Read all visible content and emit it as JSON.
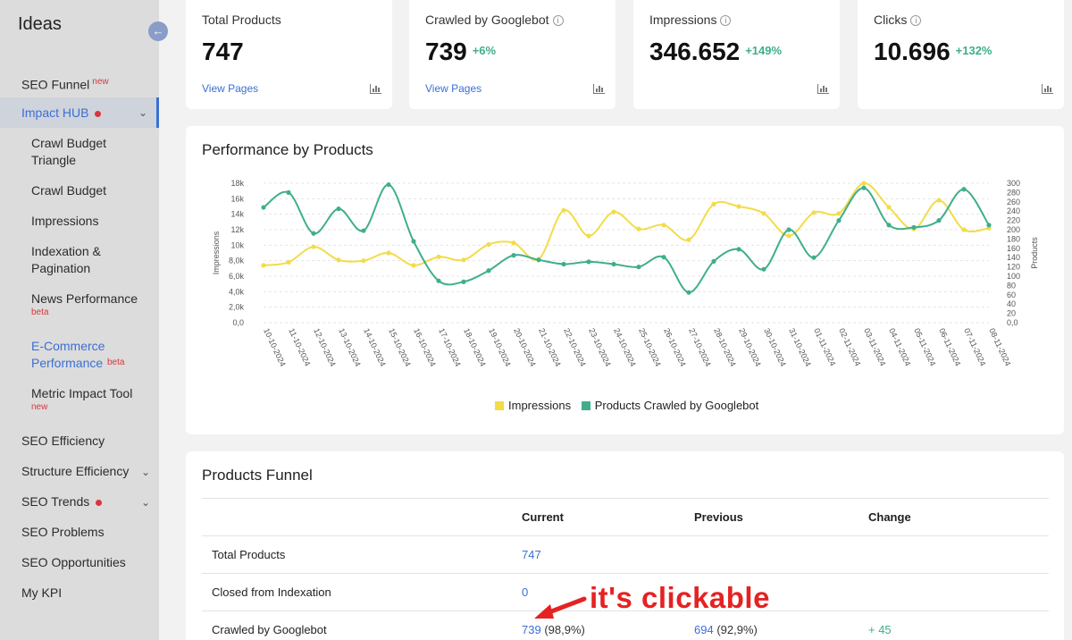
{
  "sidebar": {
    "title": "Ideas",
    "collapse_icon": "arrow-left-icon",
    "items": [
      {
        "label": "SEO Funnel",
        "badge": "new"
      },
      {
        "label": "Impact HUB"
      },
      {
        "label": "Crawl Budget Triangle"
      },
      {
        "label": "Crawl Budget"
      },
      {
        "label": "Impressions"
      },
      {
        "label": "Indexation & Pagination"
      },
      {
        "label": "News Performance",
        "badge": "beta"
      },
      {
        "label": "E-Commerce Performance",
        "badge": "beta"
      },
      {
        "label": "Metric Impact Tool",
        "badge": "new"
      },
      {
        "label": "SEO Efficiency"
      },
      {
        "label": "Structure Efficiency"
      },
      {
        "label": "SEO Trends"
      },
      {
        "label": "SEO Problems"
      },
      {
        "label": "SEO Opportunities"
      },
      {
        "label": "My KPI"
      }
    ]
  },
  "kpis": [
    {
      "label": "Total Products",
      "value": "747",
      "delta": "",
      "link": "View Pages"
    },
    {
      "label": "Crawled by Googlebot",
      "value": "739",
      "delta": "+6%",
      "link": "View Pages"
    },
    {
      "label": "Impressions",
      "value": "346.652",
      "delta": "+149%",
      "link": ""
    },
    {
      "label": "Clicks",
      "value": "10.696",
      "delta": "+132%",
      "link": ""
    }
  ],
  "performance": {
    "title": "Performance by Products"
  },
  "chart_data": {
    "type": "line",
    "x": [
      "10-10-2024",
      "11-10-2024",
      "12-10-2024",
      "13-10-2024",
      "14-10-2024",
      "15-10-2024",
      "16-10-2024",
      "17-10-2024",
      "18-10-2024",
      "19-10-2024",
      "20-10-2024",
      "21-10-2024",
      "22-10-2024",
      "23-10-2024",
      "24-10-2024",
      "25-10-2024",
      "26-10-2024",
      "27-10-2024",
      "28-10-2024",
      "29-10-2024",
      "30-10-2024",
      "31-10-2024",
      "01-11-2024",
      "02-11-2024",
      "03-11-2024",
      "04-11-2024",
      "05-11-2024",
      "06-11-2024",
      "07-11-2024",
      "08-11-2024"
    ],
    "ylabel_left": "Impressions",
    "ylabel_right": "Products",
    "y_left_ticks": [
      "0,0",
      "2,0k",
      "4,0k",
      "6,0k",
      "8,0k",
      "10k",
      "12k",
      "14k",
      "16k",
      "18k"
    ],
    "y_right_ticks": [
      "0,0",
      "20",
      "40",
      "60",
      "80",
      "100",
      "120",
      "140",
      "160",
      "180",
      "200",
      "220",
      "240",
      "260",
      "280",
      "300"
    ],
    "ylim_left": [
      0,
      18000
    ],
    "ylim_right": [
      0,
      300
    ],
    "series": [
      {
        "name": "Impressions",
        "axis": "left",
        "color": "#f2dc4a",
        "values": [
          7400,
          7800,
          9800,
          8100,
          8000,
          9000,
          7400,
          8500,
          8100,
          10100,
          10300,
          8200,
          14500,
          11200,
          14300,
          12100,
          12600,
          10700,
          15300,
          15000,
          14100,
          11200,
          14200,
          14100,
          18000,
          14900,
          12100,
          15800,
          12000,
          12200
        ]
      },
      {
        "name": "Products Crawled by Googlebot",
        "axis": "right",
        "color": "#3fae8c",
        "values": [
          248,
          280,
          192,
          245,
          198,
          297,
          175,
          90,
          88,
          112,
          145,
          135,
          126,
          131,
          126,
          120,
          141,
          65,
          132,
          158,
          115,
          200,
          140,
          220,
          290,
          210,
          205,
          220,
          287,
          210
        ]
      }
    ],
    "legend_position": "bottom",
    "grid": true
  },
  "funnel": {
    "title": "Products Funnel",
    "headers": [
      "",
      "Current",
      "Previous",
      "Change"
    ],
    "rows": [
      {
        "name": "Total Products",
        "current": "747",
        "current_pct": "",
        "previous": "",
        "previous_pct": "",
        "change": ""
      },
      {
        "name": "Closed from Indexation",
        "current": "0",
        "current_pct": "",
        "previous": "",
        "previous_pct": "",
        "change": ""
      },
      {
        "name": "Crawled by Googlebot",
        "current": "739",
        "current_pct": "(98,9%)",
        "previous": "694",
        "previous_pct": "(92,9%)",
        "change": "+ 45"
      }
    ]
  },
  "annotation": {
    "text": "it's clickable",
    "color": "#e52222"
  }
}
